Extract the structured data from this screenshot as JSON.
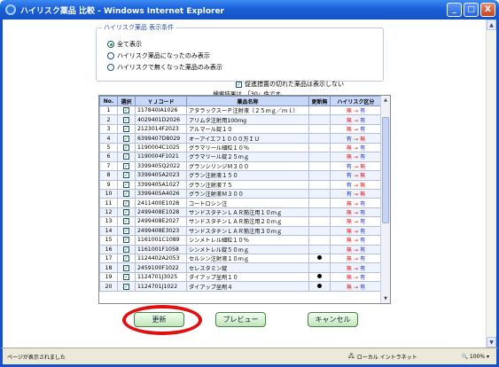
{
  "window": {
    "title": "ハイリスク薬品 比較 - Windows Internet Explorer",
    "min": "_",
    "max": "□",
    "close": "X"
  },
  "conditions": {
    "legend": "ハイリスク薬品 表示条件",
    "options": [
      {
        "label": "全て表示",
        "selected": true
      },
      {
        "label": "ハイリスク薬品になったのみ表示",
        "selected": false
      },
      {
        "label": "ハイリスクで無くなった薬品のみ表示",
        "selected": false
      }
    ],
    "exclude_label": "促進措置の切れた薬品は表示しない",
    "exclude_checked": true
  },
  "result_text": "検索結果は、「30」件です。",
  "table": {
    "headers": [
      "No.",
      "選択",
      "ＹＪコード",
      "薬品名称",
      "更新無",
      "ハイリスク区分"
    ],
    "rows": [
      {
        "no": "1",
        "yj": "117840IA1026",
        "name": "アタラックスーＰ注射液（２５ｍｇ／ｍｌ）",
        "nochg": false,
        "from": "無",
        "to": "有"
      },
      {
        "no": "2",
        "yj": "4029401D2026",
        "name": "アリムタ注射用100mg",
        "nochg": false,
        "from": "無",
        "to": "有"
      },
      {
        "no": "3",
        "yj": "2123014F2023",
        "name": "アルマール錠１０",
        "nochg": false,
        "from": "無",
        "to": "有"
      },
      {
        "no": "4",
        "yj": "6399407D8029",
        "name": "オーアイエフ１０００万ＩＵ",
        "nochg": false,
        "from": "有",
        "to": "無"
      },
      {
        "no": "5",
        "yj": "1190004C1025",
        "name": "グラマリール細粒１０％",
        "nochg": false,
        "from": "無",
        "to": "有"
      },
      {
        "no": "6",
        "yj": "1190004F1021",
        "name": "グラマリール錠２５ｍｇ",
        "nochg": false,
        "from": "無",
        "to": "有"
      },
      {
        "no": "7",
        "yj": "3399405Q2022",
        "name": "グランシリンジＭ３００",
        "nochg": false,
        "from": "有",
        "to": "無"
      },
      {
        "no": "8",
        "yj": "3399405A2023",
        "name": "グラン注射液１５０",
        "nochg": false,
        "from": "有",
        "to": "無"
      },
      {
        "no": "9",
        "yj": "3399405A1027",
        "name": "グラン注射液７５",
        "nochg": false,
        "from": "有",
        "to": "無"
      },
      {
        "no": "10",
        "yj": "3399405A4026",
        "name": "グラン注射液Ｍ３００",
        "nochg": false,
        "from": "有",
        "to": "無"
      },
      {
        "no": "11",
        "yj": "2411400E1028",
        "name": "コートロシン注",
        "nochg": false,
        "from": "無",
        "to": "有"
      },
      {
        "no": "12",
        "yj": "2499408E1028",
        "name": "サンドスタチンＬＡＲ筋注用１０ｍｇ",
        "nochg": false,
        "from": "無",
        "to": "有"
      },
      {
        "no": "13",
        "yj": "2499408E2027",
        "name": "サンドスタチンＬＡＲ筋注用２０ｍｇ",
        "nochg": false,
        "from": "無",
        "to": "有"
      },
      {
        "no": "14",
        "yj": "2499408E3023",
        "name": "サンドスタチンＬＡＲ筋注用３０ｍｇ",
        "nochg": false,
        "from": "無",
        "to": "有"
      },
      {
        "no": "15",
        "yj": "1161001C1089",
        "name": "シンメトレル細粒１０％",
        "nochg": false,
        "from": "無",
        "to": "有"
      },
      {
        "no": "16",
        "yj": "1161001F1058",
        "name": "シンメトレル錠５０ｍｇ",
        "nochg": false,
        "from": "無",
        "to": "有"
      },
      {
        "no": "17",
        "yj": "1124402A2053",
        "name": "セルシン注射液１０ｍｇ",
        "nochg": true,
        "from": "無",
        "to": "有"
      },
      {
        "no": "18",
        "yj": "2459100F1022",
        "name": "セレスタミン錠",
        "nochg": false,
        "from": "無",
        "to": "有"
      },
      {
        "no": "19",
        "yj": "1124701J3025",
        "name": "ダイアップ坐剤１０",
        "nochg": true,
        "from": "無",
        "to": "有"
      },
      {
        "no": "20",
        "yj": "1124701J1022",
        "name": "ダイアップ坐剤４",
        "nochg": true,
        "from": "無",
        "to": "有"
      }
    ]
  },
  "buttons": {
    "update": "更新",
    "preview": "プレビュー",
    "cancel": "キャンセル"
  },
  "statusbar": {
    "left": "ページが表示されました",
    "zone": "ローカル イントラネット",
    "zoom": "100%"
  },
  "colors": {
    "risk_on": "#e0191f",
    "risk_off": "#1a2fd0",
    "title_bar": "#1553c7",
    "highlight_circle": "#e01010"
  }
}
